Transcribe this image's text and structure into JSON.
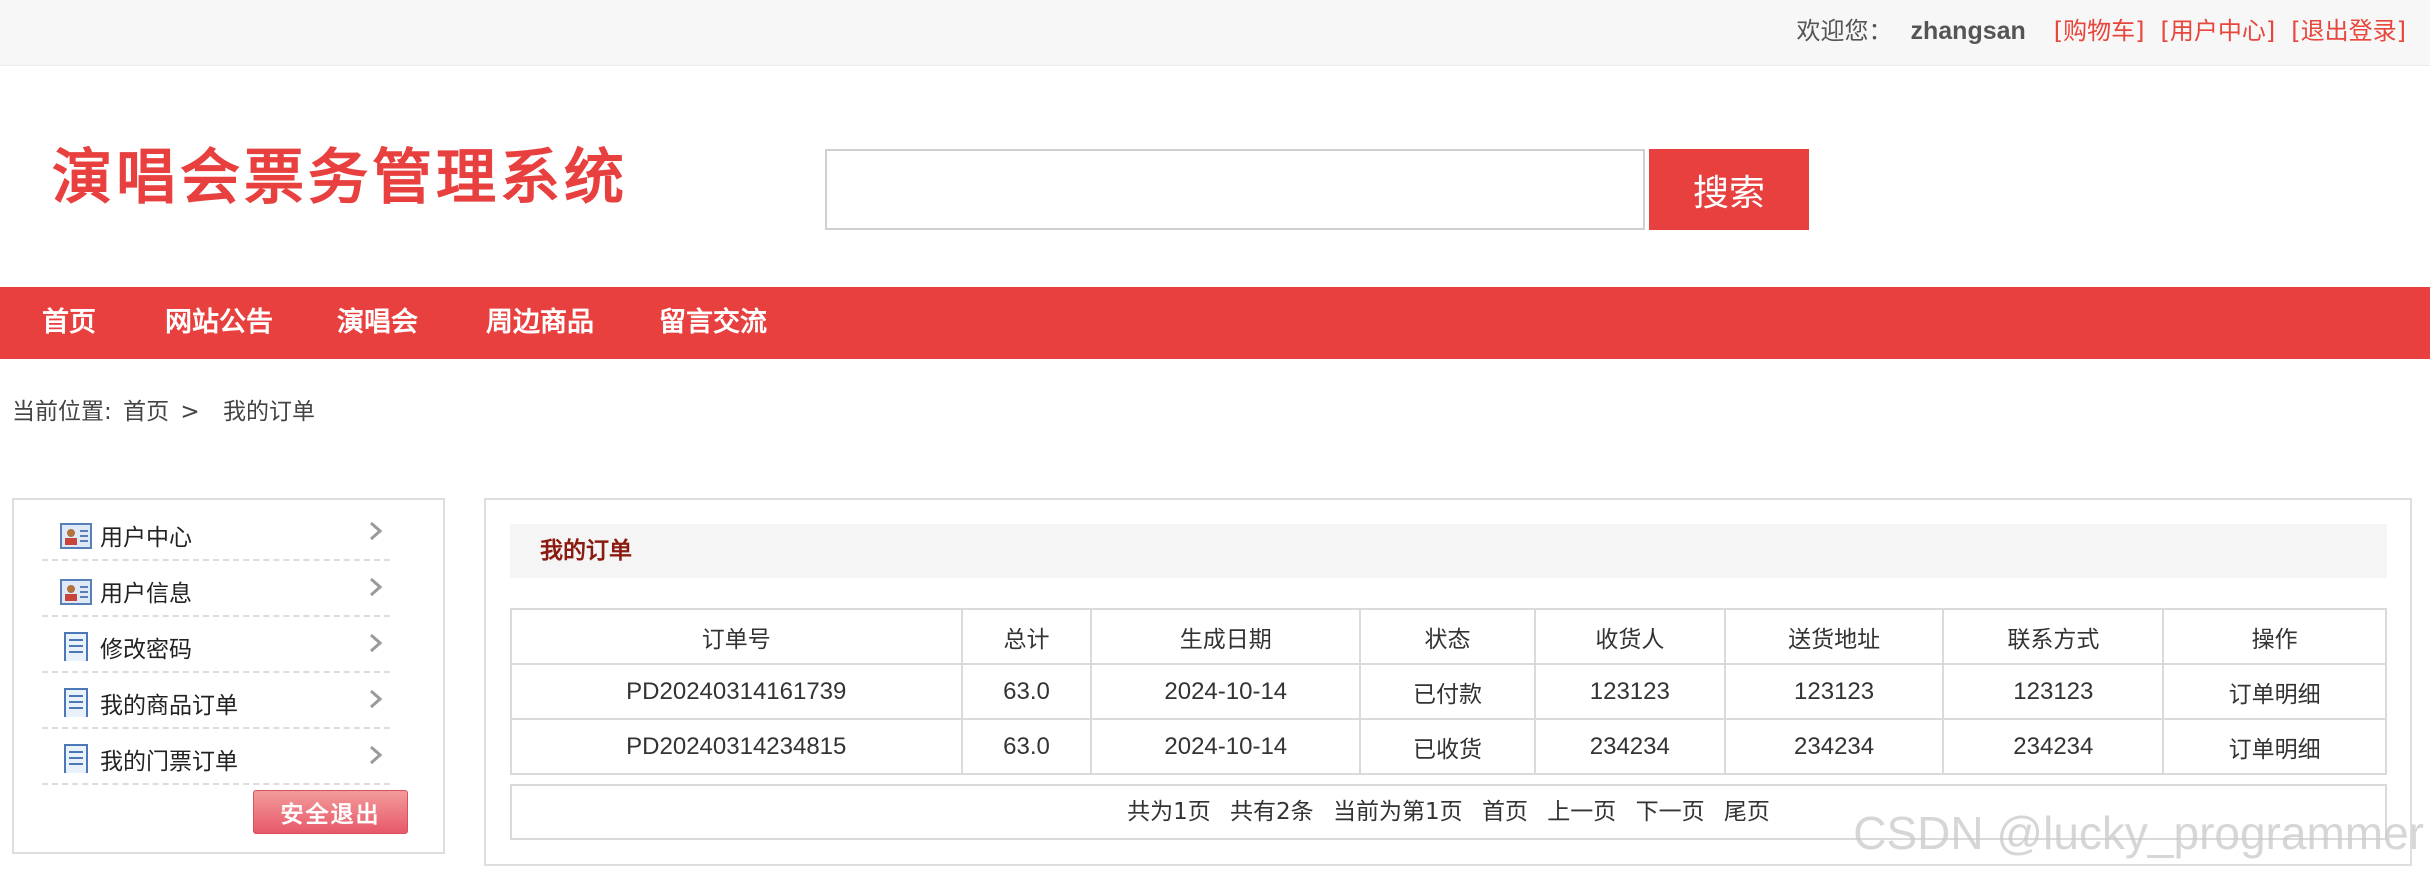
{
  "topbar": {
    "welcome": "欢迎您：",
    "username": "zhangsan",
    "links": [
      "[购物车]",
      "[用户中心]",
      "[退出登录]"
    ]
  },
  "header": {
    "logo": "演唱会票务管理系统",
    "search_placeholder": "",
    "search_button": "搜索"
  },
  "nav": [
    "首页",
    "网站公告",
    "演唱会",
    "周边商品",
    "留言交流"
  ],
  "breadcrumb": {
    "prefix": "当前位置:",
    "home": "首页",
    "sep": ">",
    "current": "我的订单"
  },
  "sidebar": {
    "items": [
      {
        "label": "用户中心",
        "icon": "id-card-icon"
      },
      {
        "label": "用户信息",
        "icon": "id-card-icon"
      },
      {
        "label": "修改密码",
        "icon": "document-icon"
      },
      {
        "label": "我的商品订单",
        "icon": "document-icon"
      },
      {
        "label": "我的门票订单",
        "icon": "document-icon"
      }
    ],
    "logout": "安全退出"
  },
  "main": {
    "title": "我的订单",
    "columns": [
      "订单号",
      "总计",
      "生成日期",
      "状态",
      "收货人",
      "送货地址",
      "联系方式",
      "操作"
    ],
    "rows": [
      [
        "PD20240314161739",
        "63.0",
        "2024-10-14",
        "已付款",
        "123123",
        "123123",
        "123123",
        "订单明细"
      ],
      [
        "PD20240314234815",
        "63.0",
        "2024-10-14",
        "已收货",
        "234234",
        "234234",
        "234234",
        "订单明细"
      ]
    ],
    "pager": {
      "total_pages": "共为1页",
      "total_items": "共有2条",
      "current": "当前为第1页",
      "first": "首页",
      "prev": "上一页",
      "next": "下一页",
      "last": "尾页"
    }
  },
  "watermark": "CSDN @lucky_programmer",
  "colors": {
    "accent": "#e8403f",
    "title_dark_red": "#8b1a10"
  }
}
